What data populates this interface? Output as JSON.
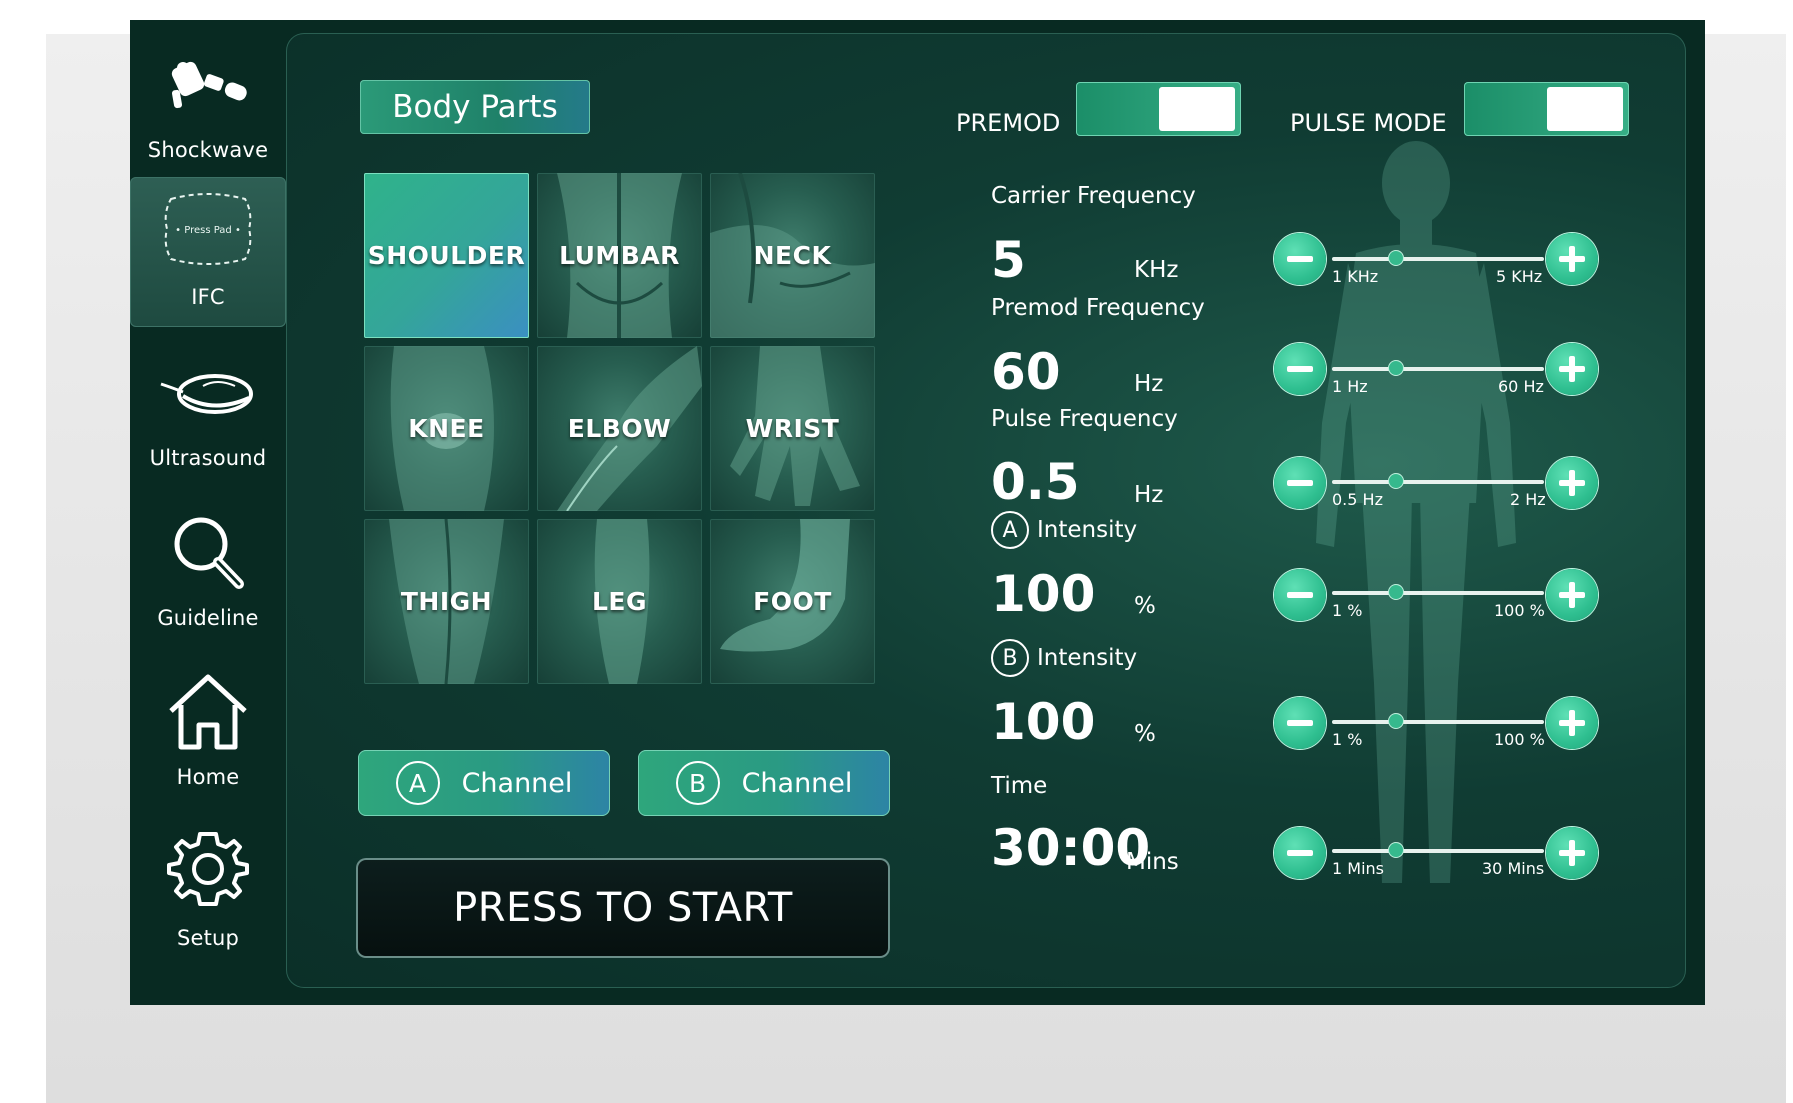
{
  "sidebar": {
    "items": [
      {
        "label": "Shockwave",
        "icon": "shockwave-icon"
      },
      {
        "label": "IFC",
        "icon": "ifc-pad-icon",
        "pad_text": "• Press Pad •",
        "active": true
      },
      {
        "label": "Ultrasound",
        "icon": "ultrasound-probe-icon"
      },
      {
        "label": "Guideline",
        "icon": "search-icon"
      },
      {
        "label": "Home",
        "icon": "home-icon"
      },
      {
        "label": "Setup",
        "icon": "gear-icon"
      }
    ]
  },
  "body_parts": {
    "title": "Body Parts",
    "tiles": [
      "SHOULDER",
      "LUMBAR",
      "NECK",
      "KNEE",
      "ELBOW",
      "WRIST",
      "THIGH",
      "LEG",
      "FOOT"
    ],
    "selected": "SHOULDER"
  },
  "channels": [
    {
      "letter": "A",
      "label": "Channel"
    },
    {
      "letter": "B",
      "label": "Channel"
    }
  ],
  "start_button": "PRESS TO START",
  "toggles": {
    "premod": {
      "label": "PREMOD",
      "on": true
    },
    "pulse_mode": {
      "label": "PULSE MODE",
      "on": true
    }
  },
  "params": [
    {
      "label": "Carrier Frequency",
      "value": "5",
      "unit": "KHz",
      "min": "1 KHz",
      "max": "5 KHz",
      "level": 0.3
    },
    {
      "label": "Premod Frequency",
      "value": "60",
      "unit": "Hz",
      "min": "1 Hz",
      "max": "60 Hz",
      "level": 0.3
    },
    {
      "label": "Pulse Frequency",
      "value": "0.5",
      "unit": "Hz",
      "min": "0.5 Hz",
      "max": "2 Hz",
      "level": 0.3
    },
    {
      "label": "Intensity",
      "badge": "A",
      "value": "100",
      "unit": "%",
      "min": "1 %",
      "max": "100 %",
      "level": 0.3
    },
    {
      "label": "Intensity",
      "badge": "B",
      "value": "100",
      "unit": "%",
      "min": "1 %",
      "max": "100 %",
      "level": 0.3
    },
    {
      "label": "Time",
      "value": "30:00",
      "unit": "Mins",
      "min": "1 Mins",
      "max": "30 Mins",
      "level": 0.3
    }
  ],
  "colors": {
    "accent": "#2fbf90",
    "panel": "#103c33",
    "frame": "#082a22"
  }
}
